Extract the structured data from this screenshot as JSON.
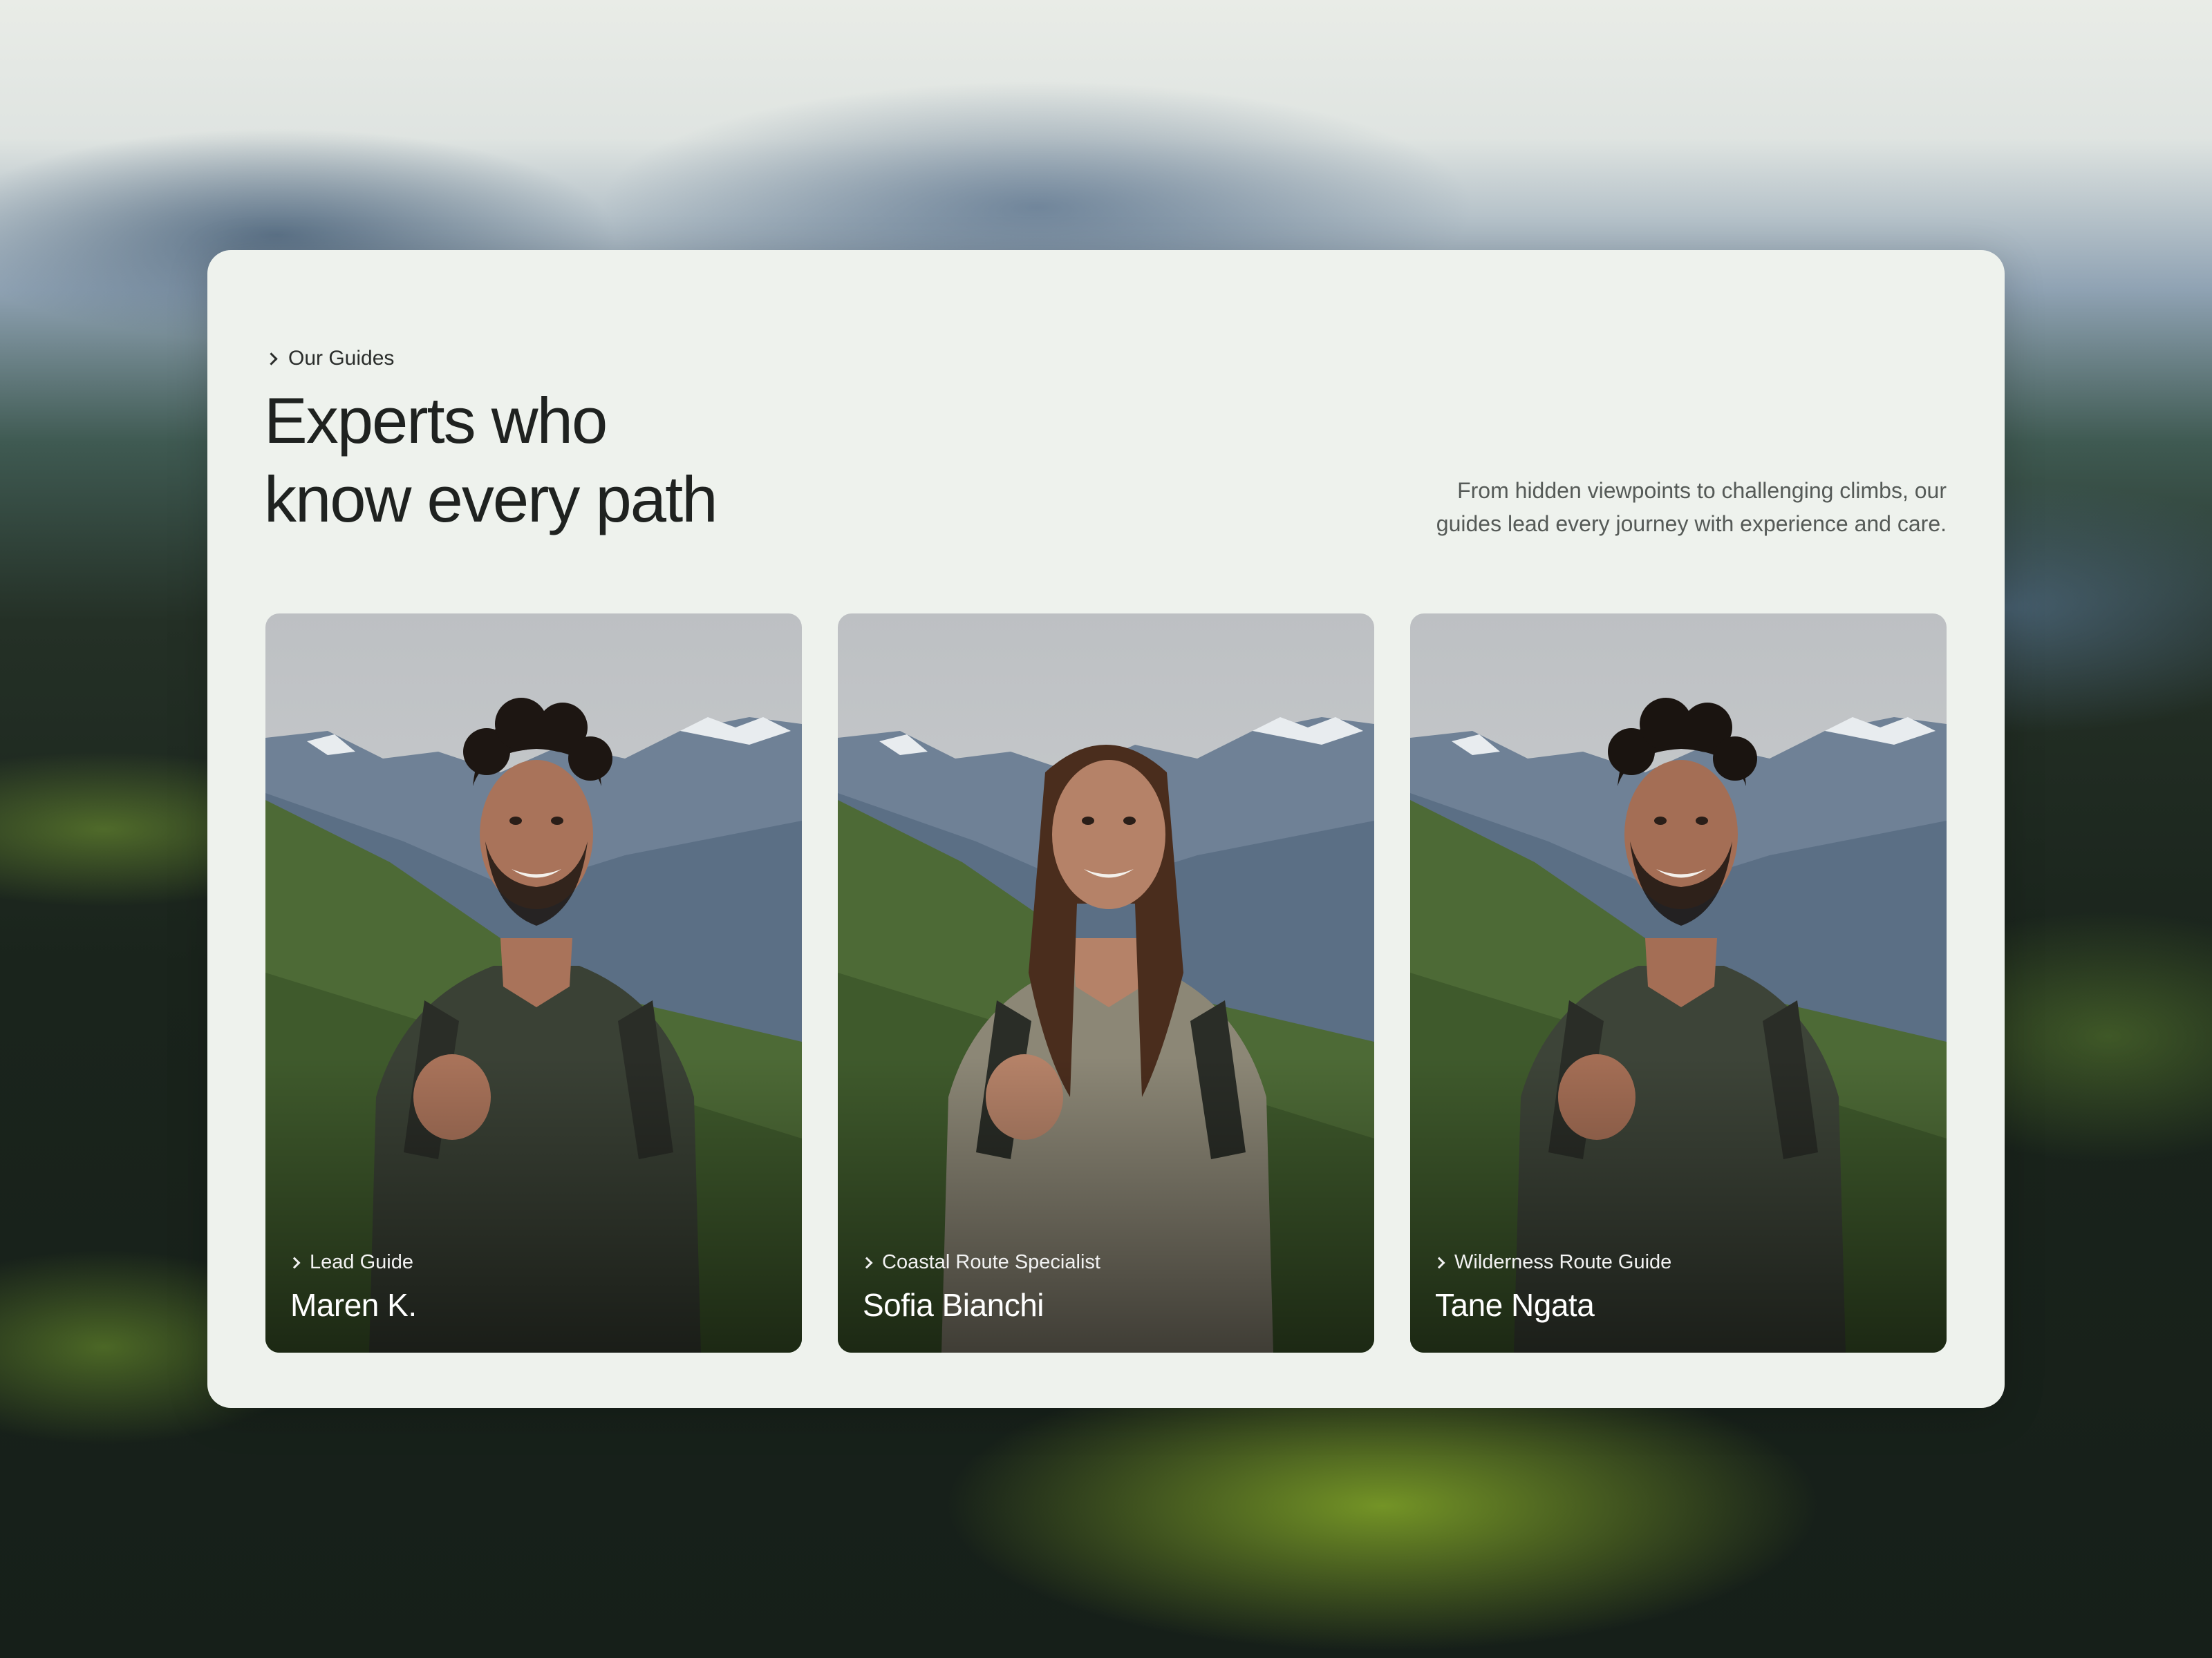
{
  "section": {
    "eyebrow": "Our Guides",
    "headline_line1": "Experts who",
    "headline_line2": "know every path",
    "intro_line1": "From hidden viewpoints to challenging climbs, our",
    "intro_line2": "guides lead every journey with experience and care."
  },
  "guides": [
    {
      "role": "Lead Guide",
      "name": "Maren K.",
      "jacket_color": "#3a4135",
      "hair_color": "#1d1612",
      "skin_color": "#a9735a"
    },
    {
      "role": "Coastal Route Specialist",
      "name": "Sofia Bianchi",
      "jacket_color": "#8c8776",
      "hair_color": "#4a2d1d",
      "skin_color": "#b58268"
    },
    {
      "role": "Wilderness Route Guide",
      "name": "Tane Ngata",
      "jacket_color": "#3d4438",
      "hair_color": "#1a1410",
      "skin_color": "#a46e55"
    }
  ],
  "colors": {
    "panel_bg": "#eef2ed",
    "heading": "#1f2220",
    "body_text": "#555a57",
    "sky": "#d9dcdd",
    "mountain": "#6f8196",
    "hillside": "#4d6a36"
  },
  "icons": {
    "eyebrow": "chevron-right-icon",
    "card_role": "chevron-right-icon"
  }
}
